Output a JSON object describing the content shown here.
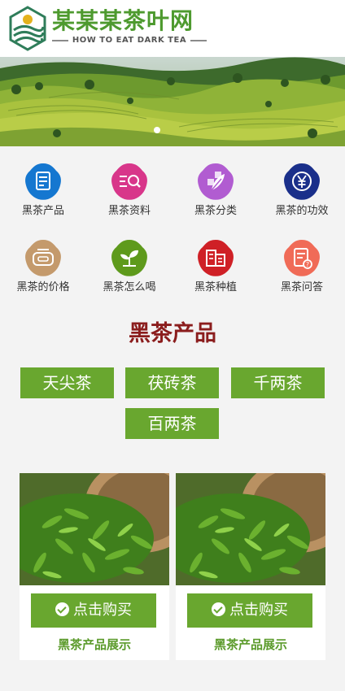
{
  "header": {
    "brand_name": "某某某茶叶网",
    "brand_subtitle": "HOW TO EAT DARK TEA",
    "logo_icon": "tea-hills-logo-icon"
  },
  "banner": {
    "slides_total": 1,
    "active_slide": 1
  },
  "categories": [
    {
      "label": "黑茶产品",
      "icon": "document-icon",
      "color": "#1577d0"
    },
    {
      "label": "黑茶资料",
      "icon": "search-list-icon",
      "color": "#d8368a"
    },
    {
      "label": "黑茶分类",
      "icon": "grid-leaf-icon",
      "color": "#b15cd1"
    },
    {
      "label": "黑茶的功效",
      "icon": "yen-icon",
      "color": "#1a2f8a"
    },
    {
      "label": "黑茶的价格",
      "icon": "tea-pot-icon",
      "color": "#c49a6c"
    },
    {
      "label": "黑茶怎么喝",
      "icon": "sprout-icon",
      "color": "#5e9a1c"
    },
    {
      "label": "黑茶种植",
      "icon": "buildings-icon",
      "color": "#cf2026"
    },
    {
      "label": "黑茶问答",
      "icon": "question-doc-icon",
      "color": "#f06b57"
    }
  ],
  "products_section": {
    "title": "黑茶产品",
    "tags": [
      "天尖茶",
      "茯砖茶",
      "千两茶",
      "百两茶"
    ]
  },
  "product_cards": [
    {
      "buy_label": "点击购买",
      "caption": "黑茶产品展示"
    },
    {
      "buy_label": "点击购买",
      "caption": "黑茶产品展示"
    }
  ],
  "colors": {
    "brand_green": "#4e9a2f",
    "button_green": "#69a72f",
    "section_title_red": "#8b1d1d",
    "page_bg": "#f3f3f3"
  }
}
